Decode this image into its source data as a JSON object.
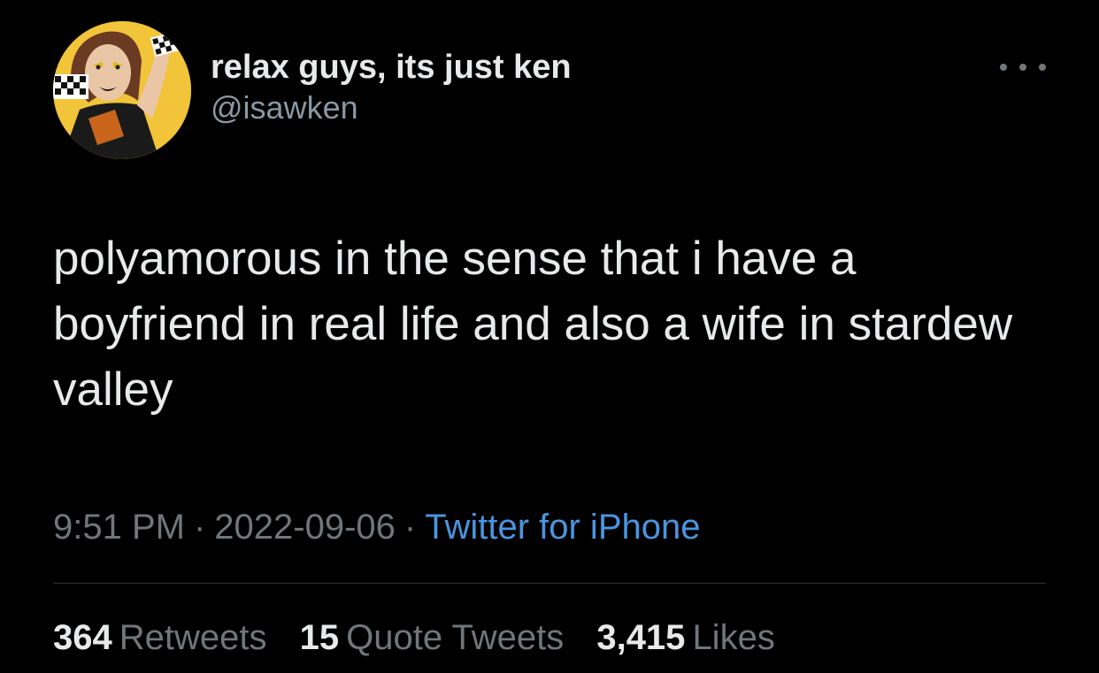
{
  "tweet": {
    "author": {
      "display_name": "relax guys, its just ken",
      "handle": "@isawken",
      "avatar_icon": "profile-photo"
    },
    "more_icon": "more-options-icon",
    "text": "polyamorous in the sense that i have a boyfriend in real life and also a wife in stardew valley",
    "time": "9:51 PM",
    "separator": "·",
    "date": "2022-09-06",
    "source": "Twitter for iPhone",
    "stats": {
      "retweets_count": "364",
      "retweets_label": "Retweets",
      "quotes_count": "15",
      "quotes_label": "Quote Tweets",
      "likes_count": "3,415",
      "likes_label": "Likes"
    }
  },
  "colors": {
    "background": "#000000",
    "primary_text": "#e7e9ea",
    "secondary_text": "#71767b",
    "link": "#4a95df",
    "divider": "#2f3336"
  }
}
